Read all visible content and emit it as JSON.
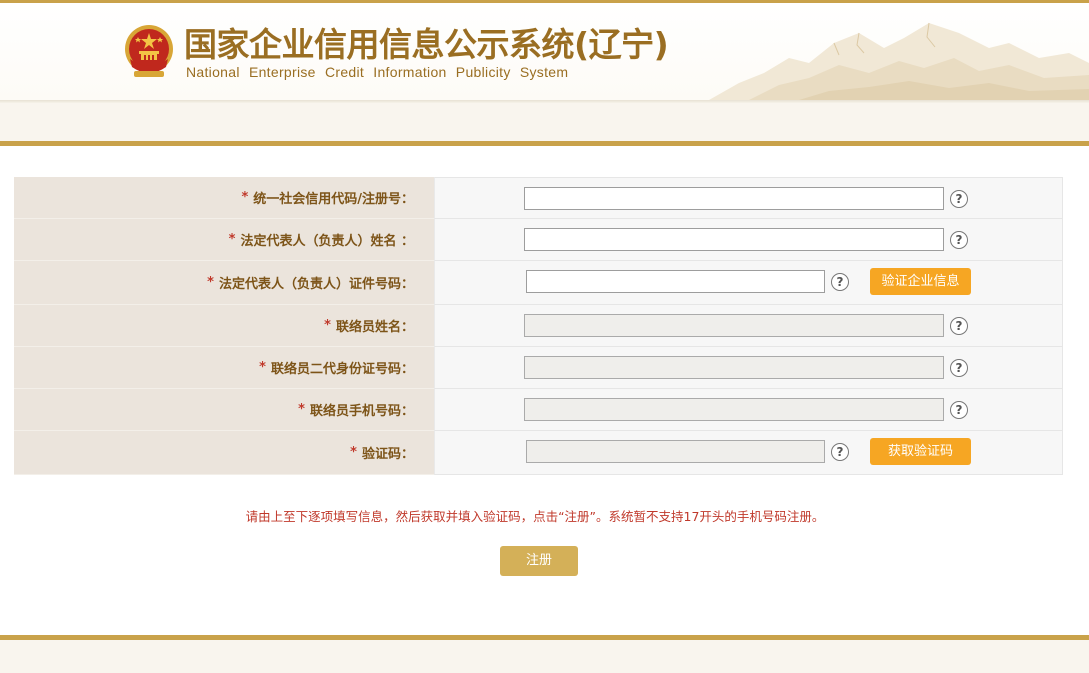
{
  "header": {
    "title_cn": "国家企业信用信息公示系统(辽宁)",
    "title_en": "National Enterprise Credit Information Publicity System"
  },
  "form": {
    "rows": [
      {
        "label": "统一社会信用代码/注册号：",
        "required": "*",
        "value": "",
        "disabled": false,
        "help": "?"
      },
      {
        "label": "法定代表人（负责人）姓名 ：",
        "required": "*",
        "value": "",
        "disabled": false,
        "help": "?"
      },
      {
        "label": "法定代表人（负责人）证件号码：",
        "required": "*",
        "value": "",
        "disabled": false,
        "help": "?",
        "button": "验证企业信息"
      },
      {
        "label": "联络员姓名：",
        "required": "*",
        "value": "",
        "disabled": true,
        "help": "?"
      },
      {
        "label": "联络员二代身份证号码：",
        "required": "*",
        "value": "",
        "disabled": true,
        "help": "?"
      },
      {
        "label": "联络员手机号码：",
        "required": "*",
        "value": "",
        "disabled": true,
        "help": "?"
      },
      {
        "label": "验证码：",
        "required": "*",
        "value": "",
        "disabled": true,
        "help": "?",
        "button": "获取验证码"
      }
    ]
  },
  "notice": "请由上至下逐项填写信息，然后获取并填入验证码，点击“注册”。系统暂不支持17开头的手机号码注册。",
  "submit_label": "注册",
  "colors": {
    "gold": "#c9a24a",
    "title": "#9a6e22",
    "label": "#7d5418",
    "required": "#c0392b",
    "orange_button": "#f6a623",
    "submit_button": "#d4b058"
  }
}
